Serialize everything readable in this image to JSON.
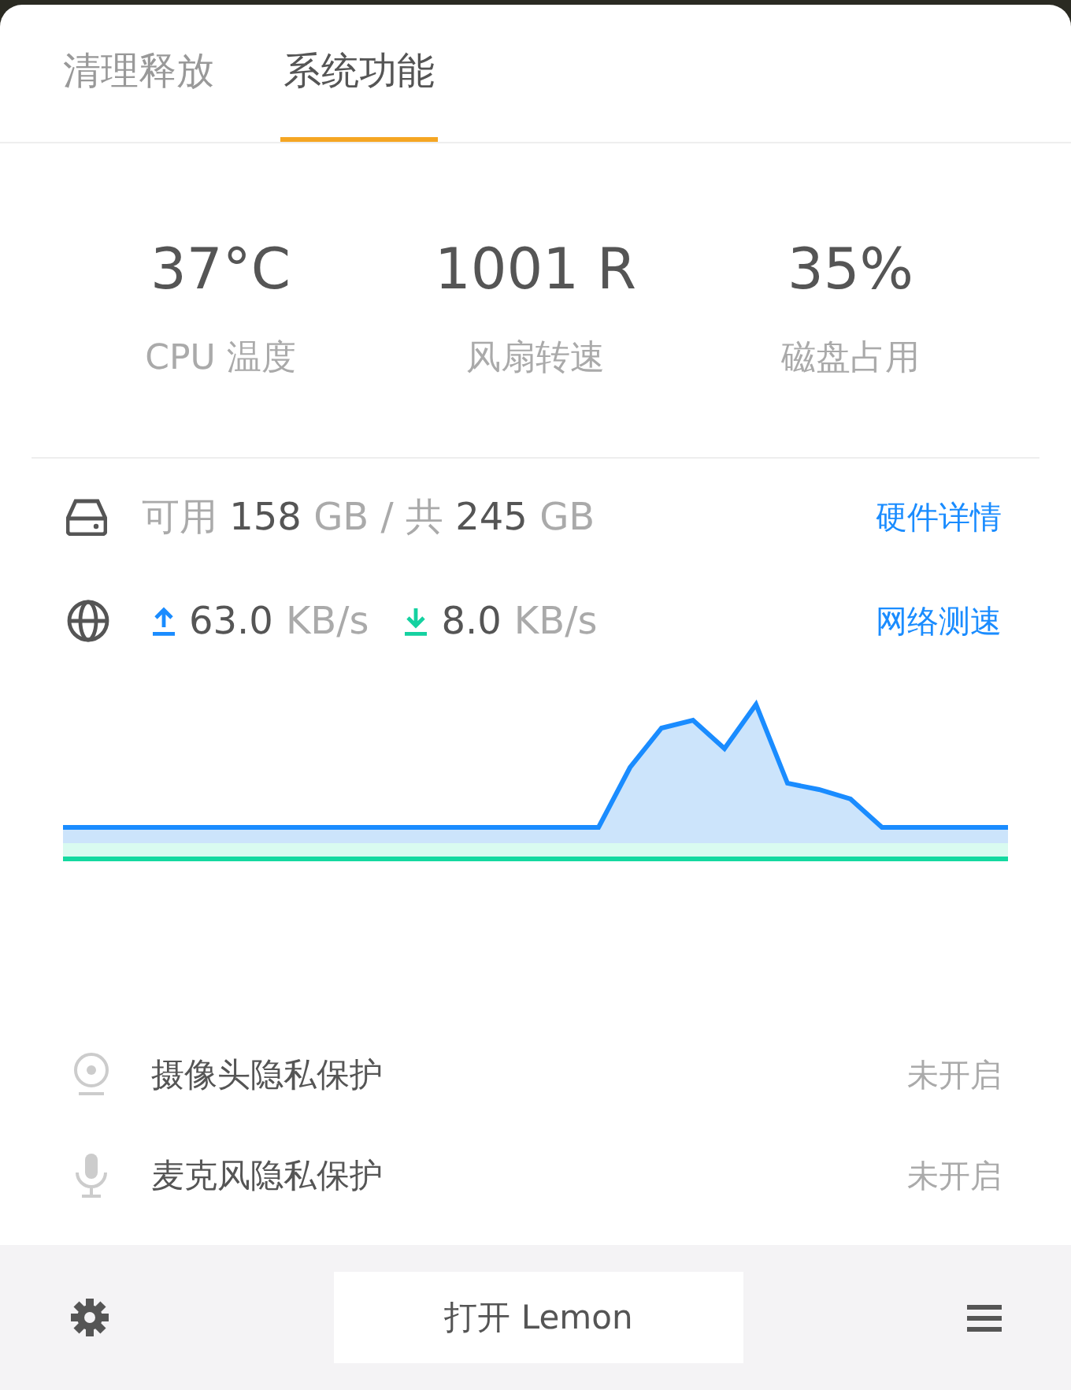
{
  "tabs": [
    {
      "label": "清理释放",
      "selected": false
    },
    {
      "label": "系统功能",
      "selected": true
    }
  ],
  "stats": [
    {
      "value": "37°C",
      "label": "CPU 温度"
    },
    {
      "value": "1001 R",
      "label": "风扇转速"
    },
    {
      "value": "35%",
      "label": "磁盘占用"
    }
  ],
  "disk": {
    "text": "可用 **158** GB / 共 **245** GB",
    "link": "硬件详情"
  },
  "network": {
    "upload": {
      "value": "63.0",
      "unit": "KB/s"
    },
    "download": {
      "value": "8.0",
      "unit": "KB/s"
    },
    "link": "网络测速"
  },
  "privacy": [
    {
      "kind": "camera",
      "label": "摄像头隐私保护",
      "status": "未开启"
    },
    {
      "kind": "microphone",
      "label": "麦克风隐私保护",
      "status": "未开启"
    }
  ],
  "footer": {
    "button": "打开 Lemon"
  }
}
